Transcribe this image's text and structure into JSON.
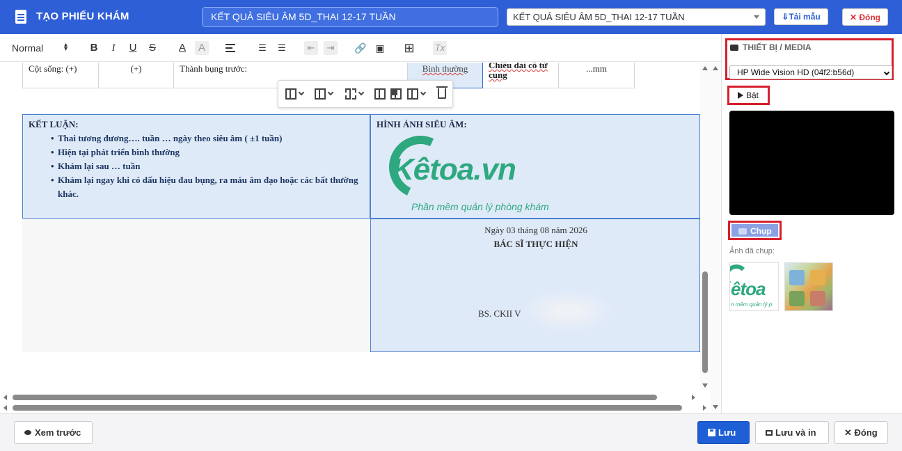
{
  "header": {
    "title": "TẠO PHIẾU KHÁM",
    "report_name": "KẾT QUẢ SIÊU ÂM 5D_THAI 12-17 TUẦN",
    "template_select": "KẾT QUẢ SIÊU ÂM 5D_THAI 12-17 TUẦN",
    "load_template_label": "⇓Tải mẫu",
    "close_label": "✕ Đóng",
    "brand_color": "#2e5fd6"
  },
  "toolbar": {
    "paragraph_style": "Normal",
    "bold": "B",
    "italic": "I",
    "underline": "U",
    "strike": "S",
    "font_color": "A",
    "highlight": "A",
    "clear_format": "Tx",
    "icons": [
      "align-left-icon",
      "ordered-list-icon",
      "bullet-list-icon",
      "outdent-icon",
      "indent-icon",
      "link-icon",
      "image-icon",
      "table-icon",
      "clear-format-icon"
    ]
  },
  "document": {
    "top_row": {
      "c1": "Cột sống: (+)",
      "c2": "(+)",
      "c3": "Thành bụng trước:",
      "c4": "Bình thường",
      "c5": "Chiều dài cổ tử cung",
      "c6": "...mm"
    },
    "conclusion": {
      "label": "KẾT LUẬN:",
      "items": [
        "Thai tương đương…. tuần … ngày theo siêu âm ( ±1 tuần)",
        "Hiện tại phát triển bình thường",
        "Khám lại sau … tuần",
        "Khám lại ngay khi có dấu hiệu đau bụng, ra máu âm đạo hoặc các bất thường khác."
      ]
    },
    "image_section": {
      "label": "HÌNH ẢNH SIÊU ÂM:",
      "logo_main": "Kêtoa.vn",
      "logo_sub": "Phần mềm quản lý phòng khám"
    },
    "signature": {
      "date": "Ngày 03 tháng 08 năm 2026",
      "title": "BÁC SĨ THỰC HIỆN",
      "doctor": "BS. CKII V"
    }
  },
  "media_panel": {
    "title": "THIẾT BỊ / MEDIA",
    "device": "HP Wide Vision HD (04f2:b56d)",
    "start_label": "Bật",
    "capture_label": "Chụp",
    "captured_label": "Ảnh đã chụp:",
    "thumb1_text": "êtoa",
    "thumb1_sub": "n mềm quản lý p"
  },
  "footer": {
    "preview_label": "Xem trước",
    "save_label": "Lưu",
    "save_print_label": "Lưu và in",
    "close_label": "✕ Đóng"
  }
}
